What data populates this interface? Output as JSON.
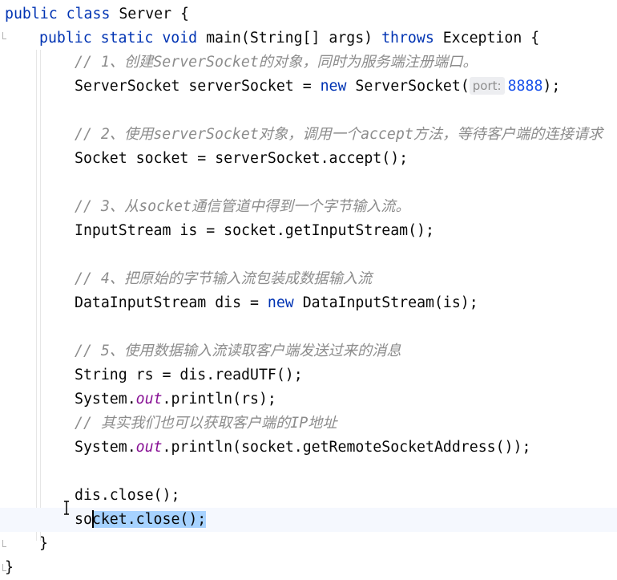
{
  "editor": {
    "lines": [
      {
        "indent": 0,
        "tokens": [
          {
            "t": "public",
            "c": "kw"
          },
          {
            "t": " "
          },
          {
            "t": "class",
            "c": "kw"
          },
          {
            "t": " Server {"
          }
        ]
      },
      {
        "indent": 1,
        "tokens": [
          {
            "t": "public",
            "c": "kw"
          },
          {
            "t": " "
          },
          {
            "t": "static",
            "c": "kw"
          },
          {
            "t": " "
          },
          {
            "t": "void",
            "c": "kw"
          },
          {
            "t": " main(String[] args) "
          },
          {
            "t": "throws",
            "c": "kw"
          },
          {
            "t": " Exception {"
          }
        ]
      },
      {
        "indent": 2,
        "tokens": [
          {
            "t": "// 1、创建ServerSocket的对象，同时为服务端注册端口。",
            "c": "cmt"
          }
        ]
      },
      {
        "indent": 2,
        "tokens": [
          {
            "t": "ServerSocket serverSocket = "
          },
          {
            "t": "new",
            "c": "kw"
          },
          {
            "t": " ServerSocket("
          },
          {
            "t": "port:",
            "c": "hint"
          },
          {
            "t": "8888",
            "c": "num"
          },
          {
            "t": ");"
          }
        ]
      },
      {
        "indent": 2,
        "tokens": []
      },
      {
        "indent": 2,
        "tokens": [
          {
            "t": "// 2、使用serverSocket对象，调用一个accept方法，等待客户端的连接请求",
            "c": "cmt"
          }
        ]
      },
      {
        "indent": 2,
        "tokens": [
          {
            "t": "Socket socket = serverSocket.accept();"
          }
        ]
      },
      {
        "indent": 2,
        "tokens": []
      },
      {
        "indent": 2,
        "tokens": [
          {
            "t": "// 3、从socket通信管道中得到一个字节输入流。",
            "c": "cmt"
          }
        ]
      },
      {
        "indent": 2,
        "tokens": [
          {
            "t": "InputStream is = socket.getInputStream();"
          }
        ]
      },
      {
        "indent": 2,
        "tokens": []
      },
      {
        "indent": 2,
        "tokens": [
          {
            "t": "// 4、把原始的字节输入流包装成数据输入流",
            "c": "cmt"
          }
        ]
      },
      {
        "indent": 2,
        "tokens": [
          {
            "t": "DataInputStream dis = "
          },
          {
            "t": "new",
            "c": "kw"
          },
          {
            "t": " DataInputStream(is);"
          }
        ]
      },
      {
        "indent": 2,
        "tokens": []
      },
      {
        "indent": 2,
        "tokens": [
          {
            "t": "// 5、使用数据输入流读取客户端发送过来的消息",
            "c": "cmt"
          }
        ]
      },
      {
        "indent": 2,
        "tokens": [
          {
            "t": "String rs = dis.readUTF();"
          }
        ]
      },
      {
        "indent": 2,
        "tokens": [
          {
            "t": "System."
          },
          {
            "t": "out",
            "c": "fld"
          },
          {
            "t": ".println(rs);"
          }
        ]
      },
      {
        "indent": 2,
        "tokens": [
          {
            "t": "// 其实我们也可以获取客户端的IP地址",
            "c": "cmt"
          }
        ]
      },
      {
        "indent": 2,
        "tokens": [
          {
            "t": "System."
          },
          {
            "t": "out",
            "c": "fld"
          },
          {
            "t": ".println(socket.getRemoteSocketAddress());"
          }
        ]
      },
      {
        "indent": 2,
        "tokens": []
      },
      {
        "indent": 2,
        "tokens": [
          {
            "t": "dis.close();"
          }
        ]
      },
      {
        "indent": 2,
        "current": true,
        "tokens": [
          {
            "t": "so"
          },
          {
            "t": "cket.close();",
            "c": "sel"
          }
        ]
      },
      {
        "indent": 1,
        "tokens": [
          {
            "t": "}"
          }
        ]
      },
      {
        "indent": 0,
        "tokens": [
          {
            "t": "}"
          }
        ]
      }
    ],
    "colors": {
      "keyword": "#0033b3",
      "number": "#1750eb",
      "static_field": "#871094",
      "comment": "#8c8c8c",
      "selection": "#a6d2ff",
      "current_line": "#f5f8fe",
      "inlay_hint_bg": "#edeef1"
    }
  }
}
